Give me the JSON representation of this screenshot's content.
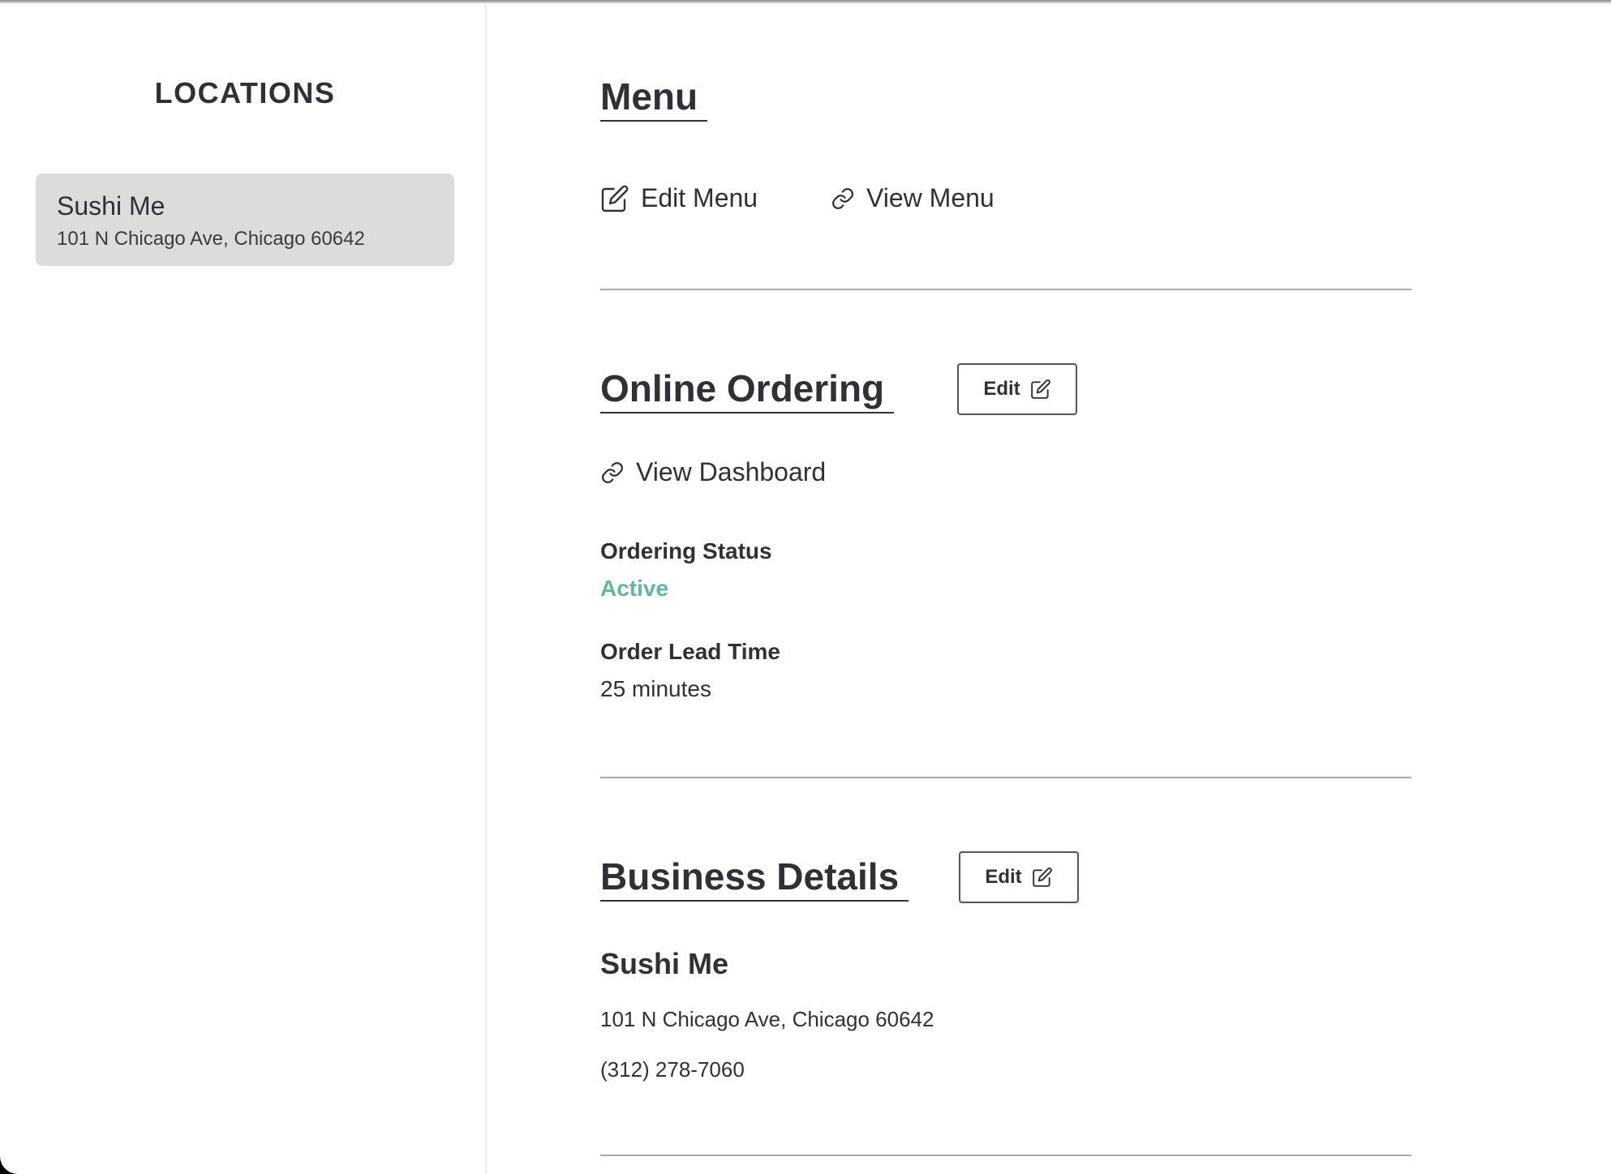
{
  "sidebar": {
    "title": "LOCATIONS",
    "locations": [
      {
        "name": "Sushi Me",
        "address": "101 N Chicago Ave, Chicago 60642",
        "selected": true
      }
    ]
  },
  "menu": {
    "heading": "Menu",
    "edit_link": "Edit Menu",
    "view_link": "View Menu"
  },
  "online_ordering": {
    "heading": "Online Ordering",
    "edit_label": "Edit",
    "dashboard_link": "View Dashboard",
    "status_label": "Ordering Status",
    "status_value": "Active",
    "lead_time_label": "Order Lead Time",
    "lead_time_value": "25 minutes"
  },
  "business_details": {
    "heading": "Business Details",
    "edit_label": "Edit",
    "name": "Sushi Me",
    "address": "101 N Chicago Ave, Chicago 60642",
    "phone": "(312) 278-7060"
  },
  "colors": {
    "status_active": "#5fb89c",
    "selected_card": "#dcdcdc",
    "text": "#2f3136",
    "divider": "#a9a9a9"
  },
  "icons": {
    "edit": "pencil-square-icon",
    "link": "chain-link-icon"
  }
}
